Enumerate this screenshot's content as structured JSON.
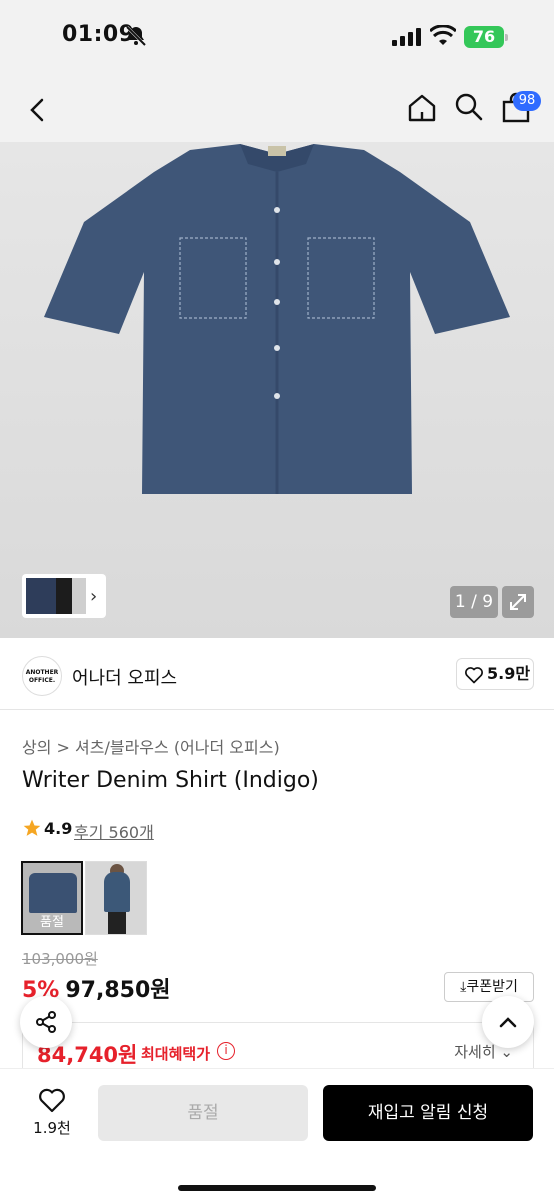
{
  "status_bar": {
    "time": "01:09",
    "battery": "76"
  },
  "navbar": {
    "cart_count": "98"
  },
  "gallery": {
    "pager": "1 / 9"
  },
  "brand": {
    "logo_text": "ANOTHER OFFICE.",
    "name": "어나더 오피스",
    "likes": "5.9만"
  },
  "product": {
    "breadcrumb": "상의 > 셔츠/블라우스 (어나더 오피스)",
    "title": "Writer Denim Shirt (Indigo)",
    "rating": "4.9",
    "reviews": "후기 560개",
    "option_sold_label": "품절"
  },
  "price": {
    "original": "103,000원",
    "discount": "5%",
    "sale": "97,850원",
    "coupon_label": "쿠폰받기",
    "benefit_price": "84,740원",
    "benefit_label": "최대혜택가",
    "detail_label": "자세히"
  },
  "bottom_bar": {
    "wish_count": "1.9천",
    "soldout_label": "품절",
    "restock_label": "재입고 알림 신청"
  },
  "colors": {
    "accent_red": "#e6212b",
    "badge_blue": "#2f6bff",
    "battery_green": "#34c759"
  }
}
